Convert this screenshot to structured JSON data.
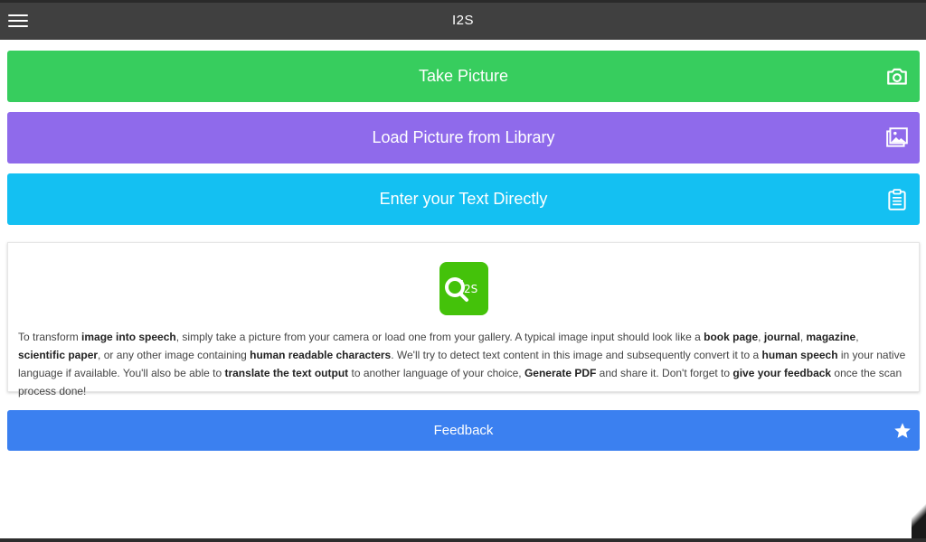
{
  "header": {
    "title": "I2S",
    "menu_icon": "hamburger-menu-icon"
  },
  "actions": [
    {
      "label": "Take Picture",
      "icon": "camera-icon",
      "color": "#37cd5e"
    },
    {
      "label": "Load Picture from Library",
      "icon": "gallery-icon",
      "color": "#8f6aeb"
    },
    {
      "label": "Enter your Text Directly",
      "icon": "clipboard-icon",
      "color": "#14c0f2"
    }
  ],
  "info_card": {
    "logo_text": "I2S",
    "logo_color": "#44c20a",
    "segments": [
      {
        "t": "To transform ",
        "b": false
      },
      {
        "t": "image into speech",
        "b": true
      },
      {
        "t": ", simply take a picture from your camera or load one from your gallery. A typical image input should look like a ",
        "b": false
      },
      {
        "t": "book page",
        "b": true
      },
      {
        "t": ", ",
        "b": false
      },
      {
        "t": "journal",
        "b": true
      },
      {
        "t": ", ",
        "b": false
      },
      {
        "t": "magazine",
        "b": true
      },
      {
        "t": ", ",
        "b": false
      },
      {
        "t": "scientific paper",
        "b": true
      },
      {
        "t": ", or any other image containing ",
        "b": false
      },
      {
        "t": "human readable characters",
        "b": true
      },
      {
        "t": ". We'll try to detect text content in this image and subsequently convert it to a ",
        "b": false
      },
      {
        "t": "human speech",
        "b": true
      },
      {
        "t": " in your native language if available. You'll also be able to ",
        "b": false
      },
      {
        "t": "translate the text output",
        "b": true
      },
      {
        "t": " to another language of your choice, ",
        "b": false
      },
      {
        "t": "Generate PDF",
        "b": true
      },
      {
        "t": " and share it. Don't forget to ",
        "b": false
      },
      {
        "t": "give your feedback",
        "b": true
      },
      {
        "t": " once the scan process done!",
        "b": false
      }
    ]
  },
  "feedback": {
    "label": "Feedback",
    "icon": "star-icon",
    "color": "#3b80f0"
  }
}
